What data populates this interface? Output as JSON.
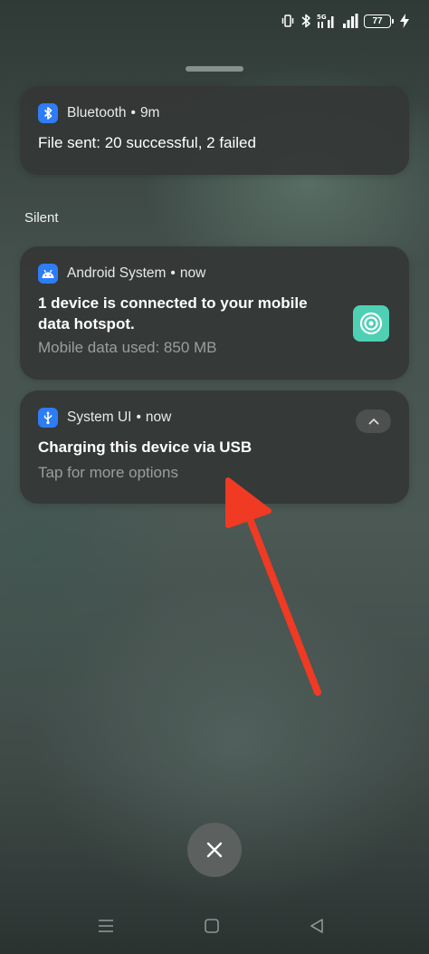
{
  "status_bar": {
    "battery_level": "77",
    "icons": [
      "vibrate-icon",
      "bluetooth-icon",
      "signal-5g-icon",
      "signal-bars-icon",
      "battery-icon",
      "charging-bolt-icon"
    ]
  },
  "notifications": {
    "bluetooth": {
      "app_name": "Bluetooth",
      "separator": "•",
      "time": "9m",
      "title": "File sent: 20 successful, 2 failed",
      "icon": "bluetooth-icon"
    },
    "section_label": "Silent",
    "android_system": {
      "app_name": "Android System",
      "separator": "•",
      "time": "now",
      "title": "1 device is connected to your mobile data hotspot.",
      "subtitle": "Mobile data used: 850 MB",
      "icon": "android-icon",
      "thumbnail_icon": "hotspot-icon"
    },
    "system_ui": {
      "app_name": "System UI",
      "separator": "•",
      "time": "now",
      "title": "Charging this device via USB",
      "subtitle": "Tap for more options",
      "icon": "usb-icon",
      "expand_icon": "chevron-up-icon"
    }
  },
  "controls": {
    "clear_all_icon": "close-icon"
  },
  "nav": {
    "icons": [
      "menu-icon",
      "home-icon",
      "back-icon"
    ]
  },
  "colors": {
    "app_icon_blue": "#2e7cf6",
    "hotspot_teal": "#4fd0b4",
    "arrow_red": "#f03a24",
    "card_bg": "#343736"
  }
}
